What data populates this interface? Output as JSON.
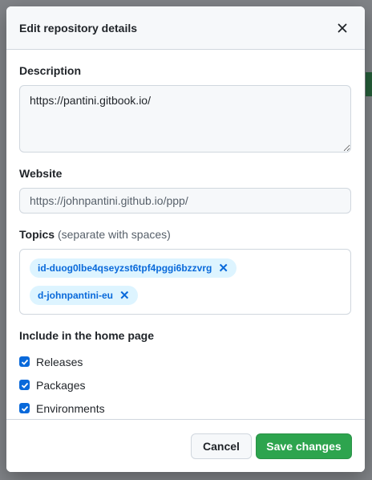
{
  "dialog": {
    "title": "Edit repository details",
    "close_icon": "close-icon"
  },
  "description": {
    "label": "Description",
    "value": "https://pantini.gitbook.io/"
  },
  "website": {
    "label": "Website",
    "value": "https://johnpantini.github.io/ppp/"
  },
  "topics": {
    "label": "Topics",
    "note": "(separate with spaces)",
    "items": [
      {
        "label": "id-duog0lbe4qseyzst6tpf4pggi6bzzvrg"
      },
      {
        "label": "d-johnpantini-eu"
      }
    ]
  },
  "home_page": {
    "label": "Include in the home page",
    "options": [
      {
        "label": "Releases",
        "checked": true
      },
      {
        "label": "Packages",
        "checked": true
      },
      {
        "label": "Environments",
        "checked": true
      }
    ]
  },
  "footer": {
    "cancel_label": "Cancel",
    "save_label": "Save changes"
  },
  "colors": {
    "accent": "#0969da",
    "save": "#2da44e",
    "topic_bg": "#ddf4ff"
  }
}
